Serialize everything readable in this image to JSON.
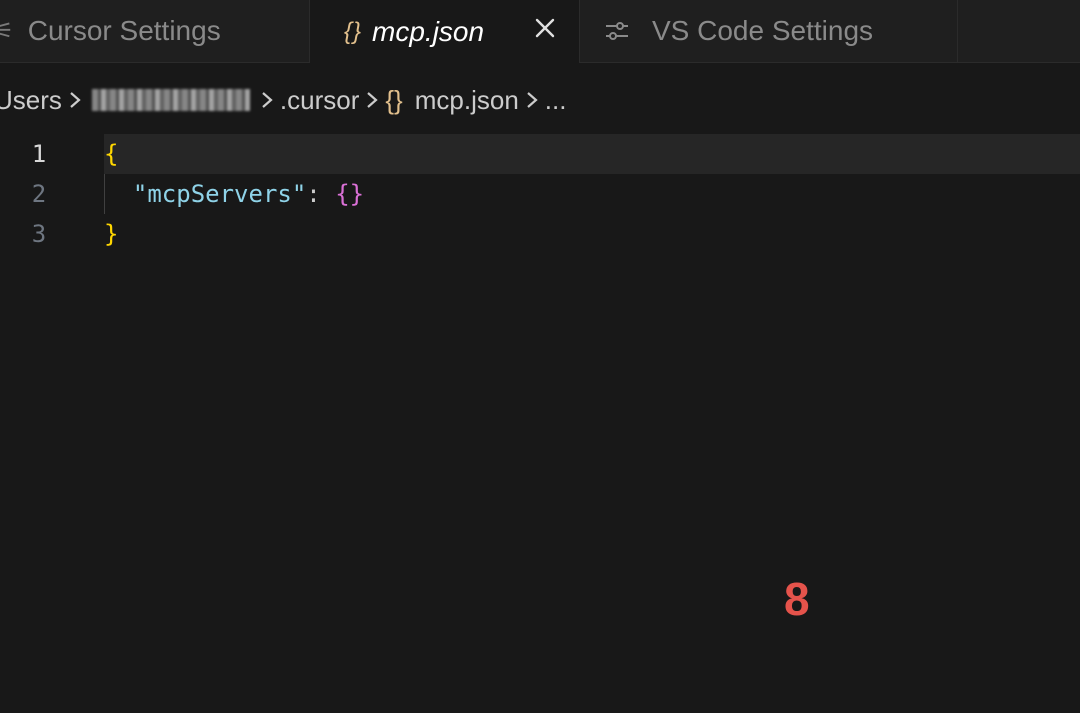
{
  "tabs": [
    {
      "label": "Cursor Settings",
      "icon": "settings-icon",
      "active": false
    },
    {
      "label": "mcp.json",
      "icon": "json-braces-icon",
      "icon_glyph": "{}",
      "active": true,
      "close_glyph": "×"
    },
    {
      "label": "VS Code Settings",
      "icon": "sliders-icon",
      "active": false
    }
  ],
  "breadcrumb": {
    "items": [
      "Users",
      ".cursor",
      "mcp.json",
      "..."
    ],
    "file_icon_glyph": "{}"
  },
  "editor": {
    "lines": [
      {
        "number": "1",
        "open": "{"
      },
      {
        "number": "2",
        "key": "\"mcpServers\"",
        "colon": ":",
        "value": "{}"
      },
      {
        "number": "3",
        "close": "}"
      }
    ]
  },
  "annotation": {
    "label": "8"
  },
  "colors": {
    "background": "#181818",
    "tab_bar": "#1f1f1f",
    "json_brace_icon": "#e2c08d",
    "bracket_level_1": "#ffd700",
    "bracket_level_2": "#da70d6",
    "json_key": "#8fd3e8",
    "annotation": "#e5534b"
  }
}
